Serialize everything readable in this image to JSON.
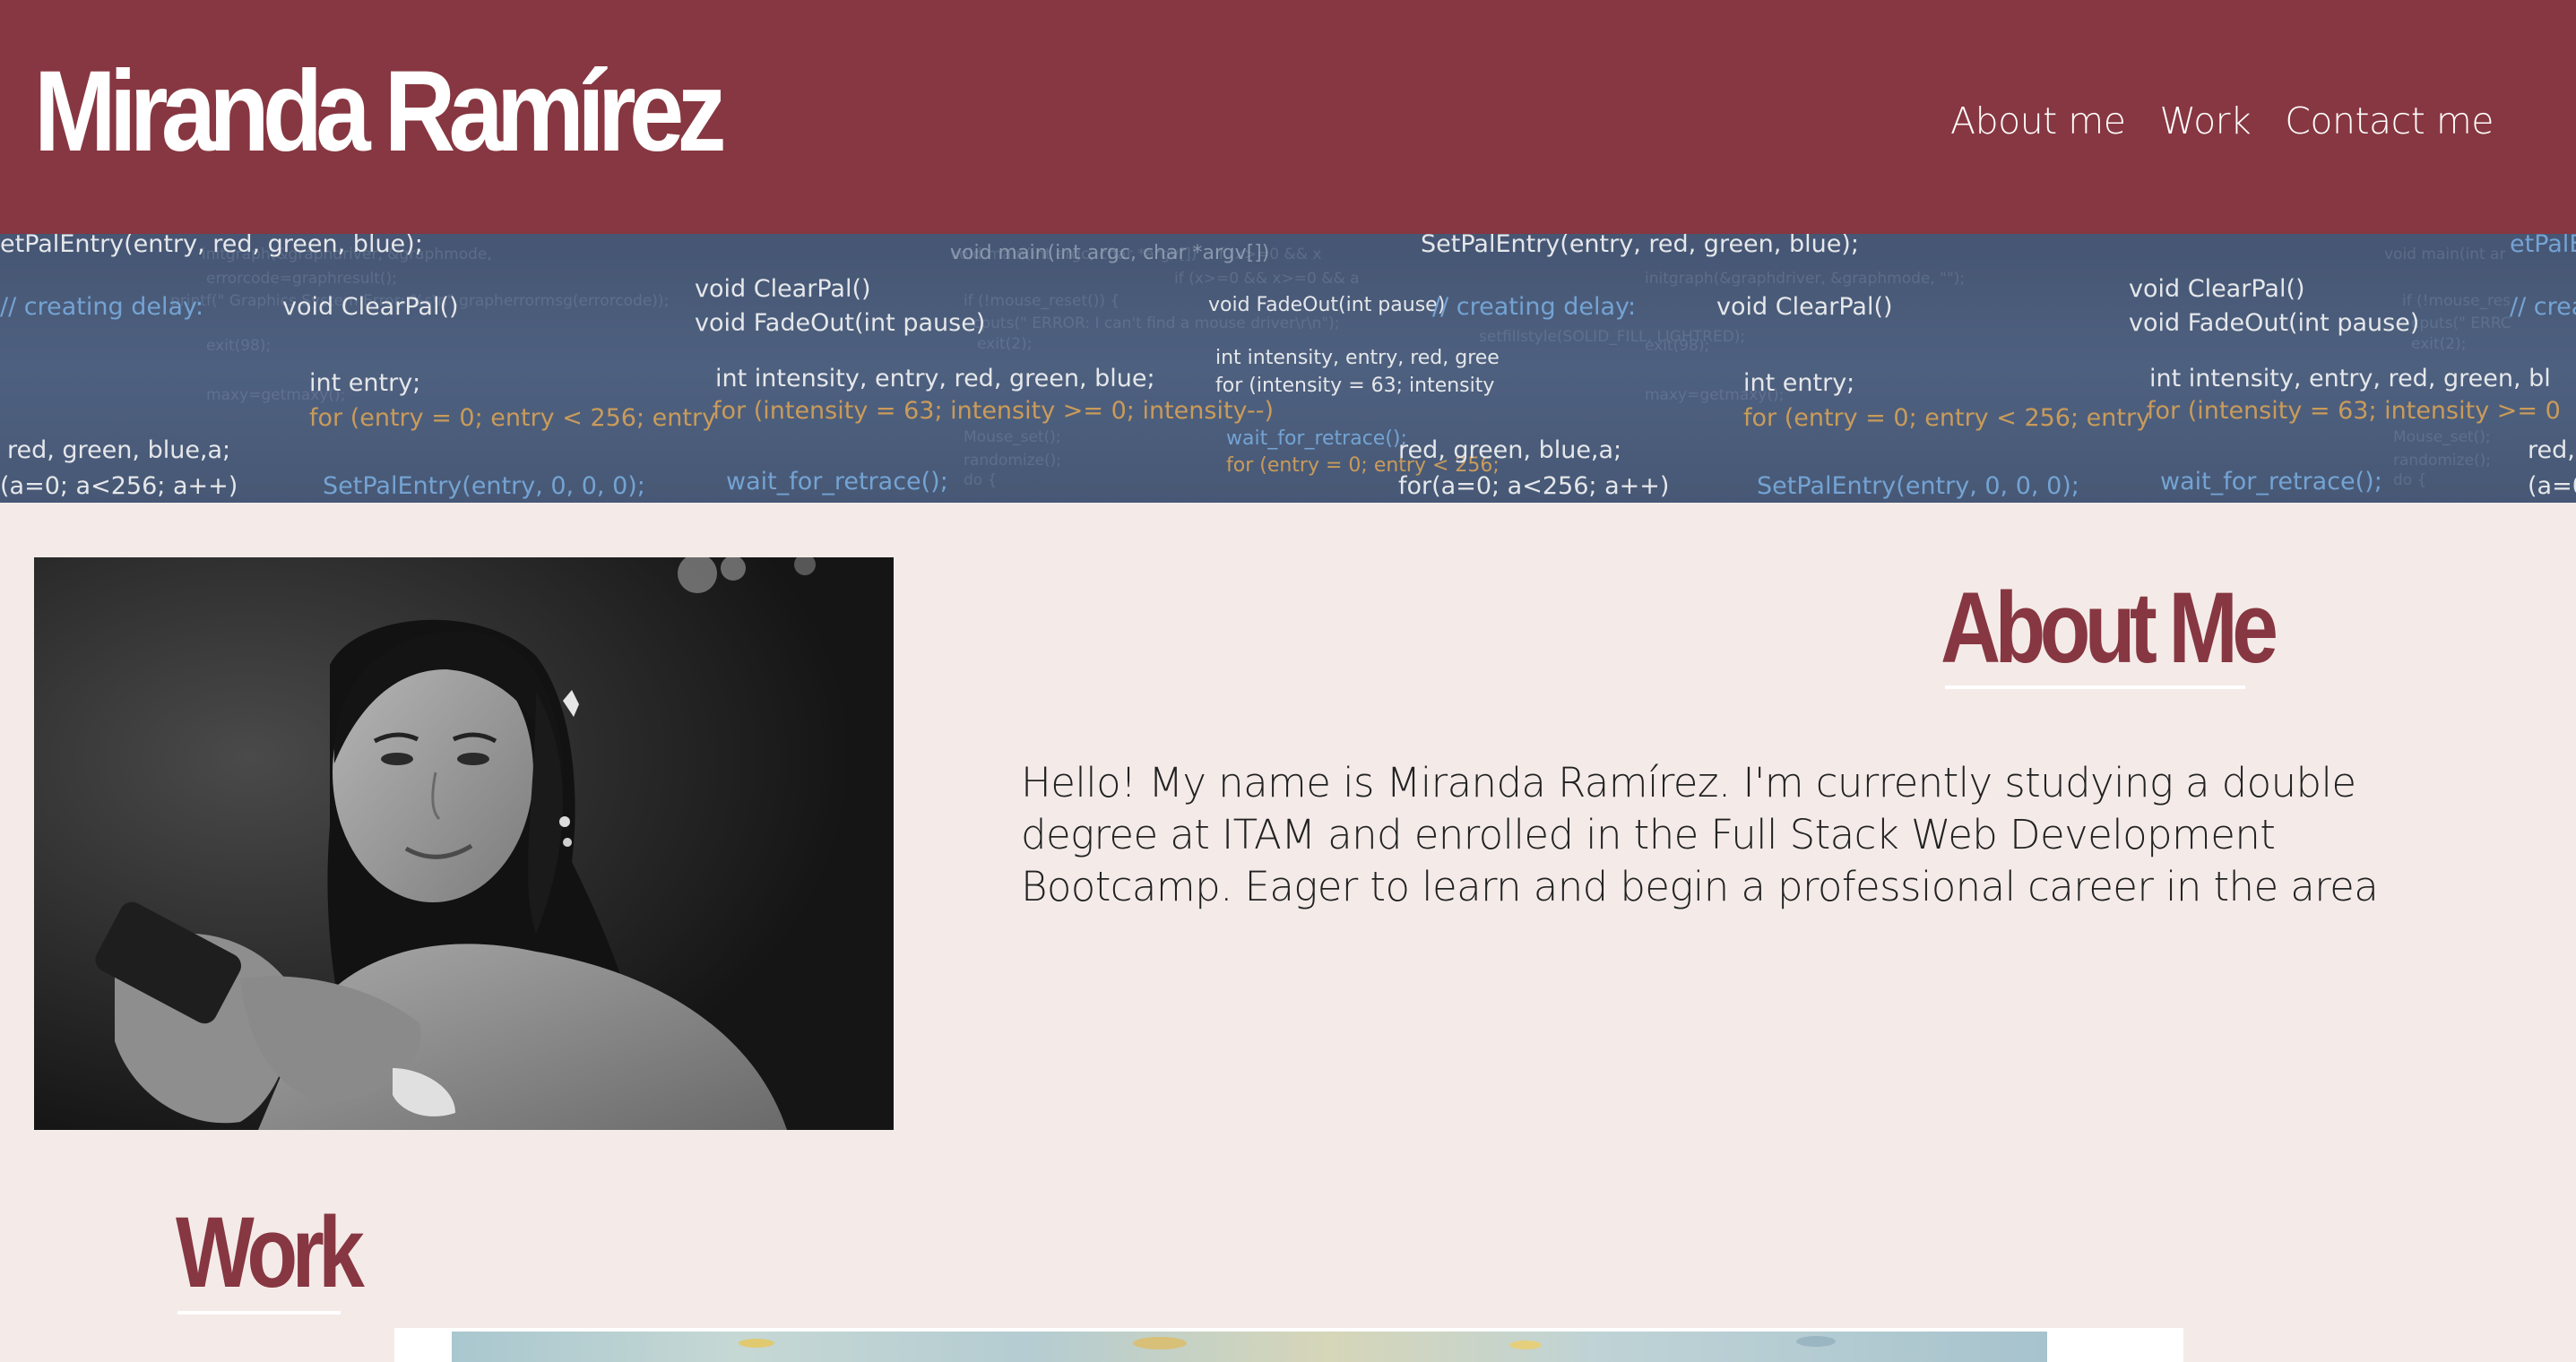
{
  "header": {
    "brand": "Miranda Ramírez",
    "background_color": "#873741",
    "nav": [
      {
        "label": "About me"
      },
      {
        "label": "Work"
      },
      {
        "label": "Contact me"
      }
    ]
  },
  "banner": {
    "code_lines": [
      "etPalEntry(entry, red, green, blue);",
      "// creating delay:",
      "void ClearPal()",
      "int entry;",
      "for (entry = 0; entry < 256; entry",
      "red, green, blue,a;",
      "(a=0; a<256; a++)",
      "SetPalEntry(entry, 0, 0, 0);",
      "void ClearPal()",
      "void FadeOut(int pause)",
      "int intensity, entry, red, green, blue;",
      "for (intensity = 63; intensity >= 0; intensity--)",
      "wait_for_retrace();",
      "void main(int argc, char *argv[])",
      "void FadeOut(int pause)",
      "int intensity, entry, red, gree",
      "for (intensity = 63; intensity",
      "wait_for_retrace();",
      "for (entry = 0; entry < 256;",
      "SetPalEntry(entry, red, green, blue);",
      "// creating delay:",
      "void ClearPal()",
      "int entry;",
      "for (entry = 0; entry < 256; entry",
      "red, green, blue,a;",
      "for(a=0; a<256; a++)",
      "SetPalEntry(entry, 0, 0, 0);",
      "void ClearPal()",
      "void FadeOut(int pause)",
      "int intensity, entry, red, green, bl",
      "for (intensity = 63; intensity >= 0",
      "wait_for_retrace();",
      "etPalE",
      "// crea",
      "red,",
      "(a=0;"
    ]
  },
  "about": {
    "heading": "About Me",
    "text": "Hello! My name is Miranda Ramírez. I'm currently studying a double degree at ITAM and enrolled in the Full Stack Web Development Bootcamp. Eager to learn and begin a professional career in the area",
    "accent_color": "#873741"
  },
  "work": {
    "heading": "Work"
  },
  "colors": {
    "page_background": "#f4ebe9",
    "accent": "#873741",
    "banner_background": "#4f6180"
  }
}
